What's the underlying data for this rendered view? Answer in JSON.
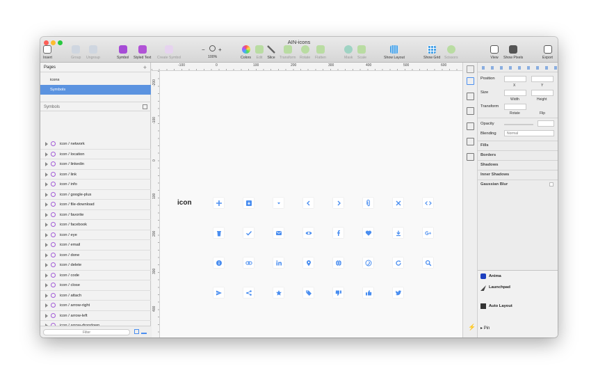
{
  "window": {
    "title": "AIN-icons"
  },
  "toolbar": {
    "insert": "Insert",
    "group": "Group",
    "ungroup": "Ungroup",
    "symbol": "Symbol",
    "styled_text": "Styled Text",
    "create_symbol": "Create Symbol",
    "zoom_minus": "−",
    "zoom_plus": "+",
    "zoom": "100%",
    "colors": "Colors",
    "edit": "Edit",
    "slice": "Slice",
    "transform": "Transform",
    "rotate": "Rotate",
    "flatten": "Flatten",
    "mask": "Mask",
    "scale": "Scale",
    "show_layout": "Show Layout",
    "show_grid": "Show Grid",
    "scissors": "Scissors",
    "view": "View",
    "show_pixels": "Show Pixels",
    "export": "Export"
  },
  "pages": {
    "title": "Pages",
    "add": "+",
    "items": [
      "icons",
      "Symbols"
    ],
    "selected": 1
  },
  "symbols": {
    "title": "Symbols",
    "layers": [
      "icon / network",
      "icon / location",
      "icon / linkedin",
      "icon / link",
      "icon / info",
      "icon / google-plus",
      "icon / file-download",
      "icon / favorite",
      "icon / facebook",
      "icon / eye",
      "icon / email",
      "icon / done",
      "icon / delete",
      "icon / code",
      "icon / close",
      "icon / attach",
      "icon / arrow-right",
      "icon / arrow-left",
      "icon / arrow-dropdown",
      "icon / archive",
      "icon / add"
    ],
    "filter_placeholder": "Filter"
  },
  "ruler": {
    "h": [
      "-100",
      "0",
      "100",
      "200",
      "300",
      "400",
      "500",
      "600"
    ],
    "v": [
      "-200",
      "-100",
      "0",
      "100",
      "200",
      "300",
      "400"
    ]
  },
  "canvas": {
    "label": "icon",
    "accent": "#4a8ef0",
    "rows": [
      [
        "plus",
        "archive",
        "dropdown",
        "arrow-left",
        "arrow-right",
        "attach",
        "close",
        "code"
      ],
      [
        "delete",
        "done",
        "email",
        "eye",
        "facebook",
        "favorite",
        "download",
        "google-plus"
      ],
      [
        "info",
        "link",
        "linkedin",
        "location",
        "network",
        "pinterest",
        "refresh",
        "search"
      ],
      [
        "send",
        "share",
        "star",
        "tag",
        "thumb-down",
        "thumb-up",
        "twitter"
      ]
    ]
  },
  "inspector": {
    "position": "Position",
    "x": "X",
    "y": "Y",
    "size": "Size",
    "width": "Width",
    "height": "Height",
    "transform": "Transform",
    "rotate": "Rotate",
    "flip": "Flip",
    "opacity": "Opacity",
    "blending": "Blending",
    "blending_value": "Normal",
    "fills": "Fills",
    "borders": "Borders",
    "shadows": "Shadows",
    "inner_shadows": "Inner Shadows",
    "gaussian_blur": "Gaussian Blur",
    "anima": "Anima",
    "launchpad": "Launchpad",
    "auto_layout": "Auto Layout",
    "pin": "Pin"
  }
}
